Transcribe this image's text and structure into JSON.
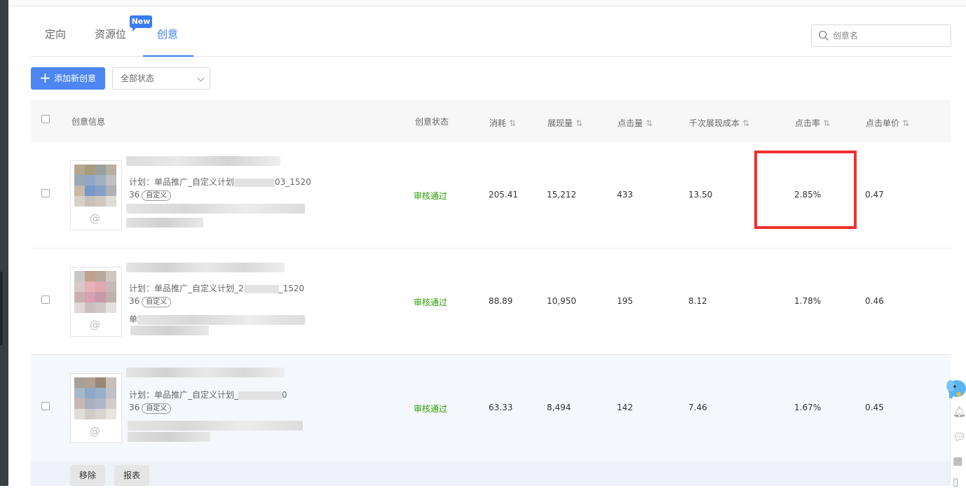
{
  "tabs": [
    {
      "label": "定向",
      "active": false
    },
    {
      "label": "资源位",
      "active": false,
      "badge": "New"
    },
    {
      "label": "创意",
      "active": true
    }
  ],
  "search": {
    "placeholder": "创意名"
  },
  "toolbar": {
    "add_label": "添加新创意",
    "status_filter": "全部状态"
  },
  "table": {
    "headers": {
      "info": "创意信息",
      "status": "创意状态",
      "cost": "消耗",
      "impressions": "展现量",
      "clicks": "点击量",
      "cpm": "千次展现成本",
      "ctr": "点击率",
      "cpc": "点击单价"
    },
    "rows": [
      {
        "plan_line1": "计划：单品推广_自定义计划",
        "plan_tail1": "03_1520",
        "plan_line2": "36",
        "tag": "自定义",
        "status": "审核通过",
        "cost": "205.41",
        "impressions": "15,212",
        "clicks": "433",
        "cpm": "13.50",
        "ctr": "2.85%",
        "cpc": "0.47",
        "highlighted_ctr": true
      },
      {
        "plan_line1": "计划：单品推广_自定义计划_2",
        "plan_tail1": "_1520",
        "plan_line2": "36",
        "tag": "自定义",
        "extra": "单",
        "status": "审核通过",
        "cost": "88.89",
        "impressions": "10,950",
        "clicks": "195",
        "cpm": "8.12",
        "ctr": "1.78%",
        "cpc": "0.46"
      },
      {
        "plan_line1": "计划：单品推广_自定义计划_",
        "plan_tail1": "0",
        "plan_line2": "36",
        "tag": "自定义",
        "status": "审核通过",
        "cost": "63.33",
        "impressions": "8,494",
        "clicks": "142",
        "cpm": "7.46",
        "ctr": "1.67%",
        "cpc": "0.45"
      }
    ]
  },
  "bulk_actions": {
    "remove": "移除",
    "report": "报表"
  },
  "colors": {
    "accent": "#3b7cf0",
    "approved": "#2aa000",
    "highlight_box": "#f0302e"
  }
}
